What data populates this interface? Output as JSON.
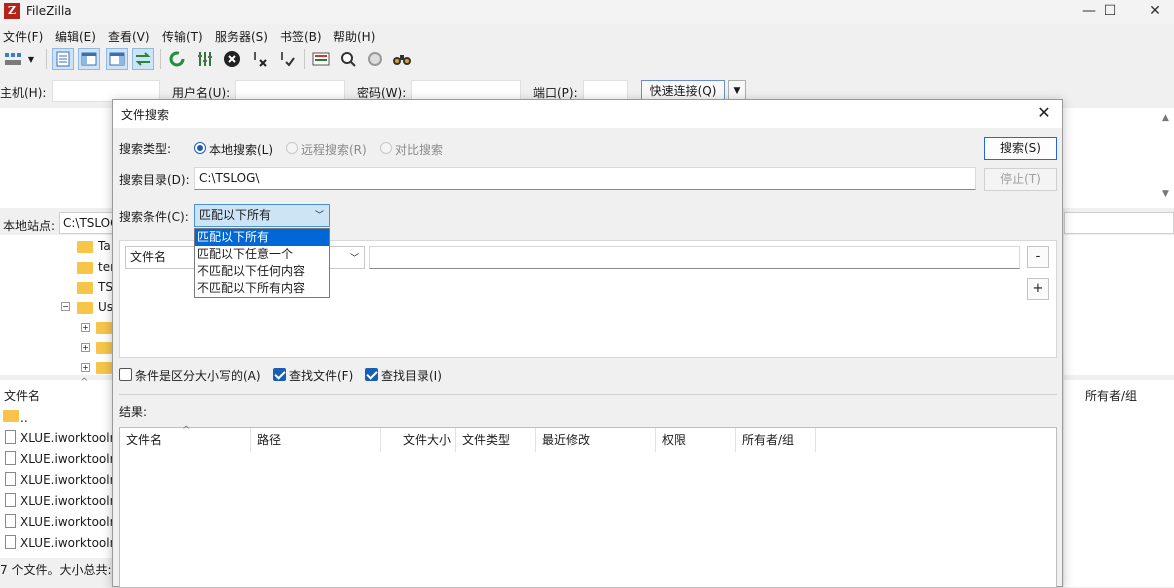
{
  "window": {
    "title": "FileZilla",
    "logo_letter": "Z",
    "minimize": "—",
    "maximize": "☐",
    "close": "✕"
  },
  "menu": [
    "文件(F)",
    "编辑(E)",
    "查看(V)",
    "传输(T)",
    "服务器(S)",
    "书签(B)",
    "帮助(H)"
  ],
  "quickconnect": {
    "host_label": "主机(H):",
    "user_label": "用户名(U):",
    "pass_label": "密码(W):",
    "port_label": "端口(P):",
    "connect_button": "快速连接(Q)",
    "arrow": "▼"
  },
  "local_panel": {
    "site_label": "本地站点:",
    "site_path": "C:\\TSLOG",
    "tree_items": [
      "Ta",
      "ter",
      "TS",
      "Us"
    ],
    "filename_header": "文件名",
    "parent_dir": "..",
    "files": [
      "XLUE.iworktoolr",
      "XLUE.iworktoolr",
      "XLUE.iworktoolr",
      "XLUE.iworktoolr",
      "XLUE.iworktoolr",
      "XLUE.iworktoolr"
    ],
    "status": "7 个文件。大小总共:"
  },
  "remote_panel": {
    "owner_header": "所有者/组"
  },
  "dialog": {
    "title": "文件搜索",
    "close": "✕",
    "search_type_label": "搜索类型:",
    "radio_local": "本地搜索(L)",
    "radio_remote": "远程搜索(R)",
    "radio_compare": "对比搜索",
    "search_button": "搜索(S)",
    "stop_button": "停止(T)",
    "search_dir_label": "搜索目录(D):",
    "search_dir_value": "C:\\TSLOG\\",
    "condition_label": "搜索条件(C):",
    "condition_selected": "匹配以下所有",
    "condition_options": [
      "匹配以下所有",
      "匹配以下任意一个",
      "不匹配以下任何内容",
      "不匹配以下所有内容"
    ],
    "field_select": "文件名",
    "minus_button": "-",
    "plus_button": "+",
    "chk_case": "条件是区分大小写的(A)",
    "chk_files": "查找文件(F)",
    "chk_dirs": "查找目录(I)",
    "results_label": "结果:",
    "result_columns": [
      "文件名",
      "路径",
      "文件大小",
      "文件类型",
      "最近修改",
      "权限",
      "所有者/组"
    ]
  }
}
